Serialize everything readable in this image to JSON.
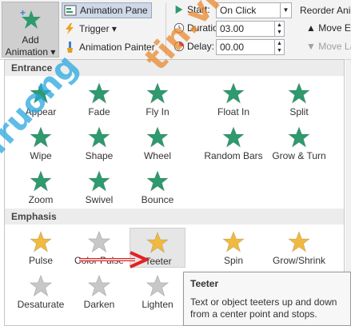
{
  "ribbon": {
    "add_animation_line1": "Add",
    "add_animation_line2": "Animation ▾",
    "animation_pane": "Animation Pane",
    "trigger": "Trigger ▾",
    "animation_painter": "Animation Painter",
    "start_label": "Start:",
    "start_value": "On Click",
    "duration_label": "Duration:",
    "duration_value": "03.00",
    "delay_label": "Delay:",
    "delay_value": "00.00",
    "reorder_label": "Reorder Ani",
    "move_earlier": "▲ Move Ea",
    "move_later": "▼ Move La"
  },
  "gallery": {
    "entrance_header": "Entrance",
    "entrance_items": [
      {
        "label": "Appear",
        "icon": "appear-star-icon"
      },
      {
        "label": "Fade",
        "icon": "fade-star-icon"
      },
      {
        "label": "Fly In",
        "icon": "fly-in-star-icon"
      },
      {
        "label": "Float In",
        "icon": "float-in-star-icon"
      },
      {
        "label": "Split",
        "icon": "split-star-icon"
      },
      {
        "label": "Wipe",
        "icon": "wipe-star-icon"
      },
      {
        "label": "Shape",
        "icon": "shape-star-icon"
      },
      {
        "label": "Wheel",
        "icon": "wheel-star-icon"
      },
      {
        "label": "Random Bars",
        "icon": "random-bars-star-icon"
      },
      {
        "label": "Grow & Turn",
        "icon": "grow-turn-star-icon"
      },
      {
        "label": "Zoom",
        "icon": "zoom-star-icon"
      },
      {
        "label": "Swivel",
        "icon": "swivel-star-icon"
      },
      {
        "label": "Bounce",
        "icon": "bounce-star-icon"
      }
    ],
    "emphasis_header": "Emphasis",
    "emphasis_items": [
      {
        "label": "Pulse",
        "icon": "pulse-star-icon"
      },
      {
        "label": "Color Pulse",
        "icon": "color-pulse-star-icon"
      },
      {
        "label": "Teeter",
        "icon": "teeter-star-icon"
      },
      {
        "label": "Spin",
        "icon": "spin-star-icon"
      },
      {
        "label": "Grow/Shrink",
        "icon": "grow-shrink-star-icon"
      },
      {
        "label": "Desaturate",
        "icon": "desaturate-star-icon"
      },
      {
        "label": "Darken",
        "icon": "darken-star-icon"
      },
      {
        "label": "Lighten",
        "icon": "lighten-star-icon"
      }
    ]
  },
  "watermark": {
    "part1": "Truong",
    "part2": "tin.vn"
  },
  "tooltip": {
    "title": "Teeter",
    "text": "Text or object teeters up and down from a center point and stops."
  },
  "colors": {
    "green_star": "#2e9a6e",
    "gold_star": "#f0b940",
    "grey_star": "#c8c8c8",
    "arrow_red": "#e32222"
  }
}
